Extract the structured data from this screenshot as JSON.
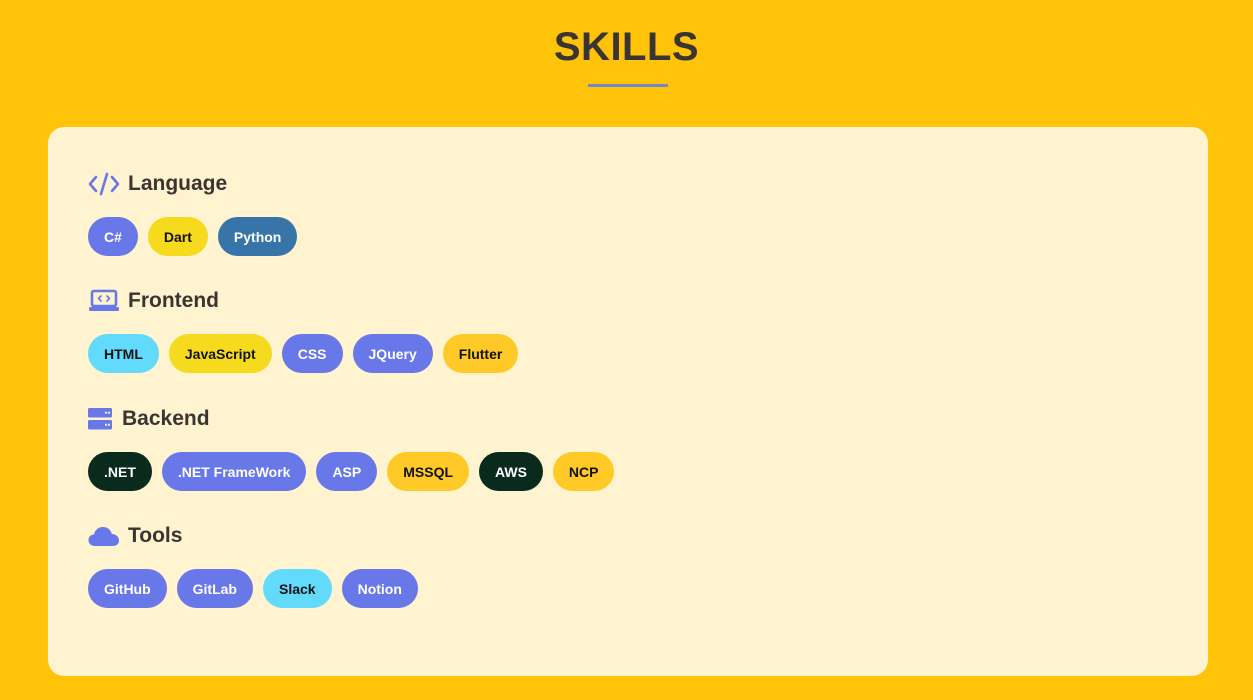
{
  "page": {
    "title": "SKILLS"
  },
  "colors": {
    "background": "#FFC30A",
    "card": "#FFF4CF",
    "accent": "#6978E8",
    "text": "#3A3433"
  },
  "sections": [
    {
      "id": "language",
      "icon": "code-icon",
      "title": "Language",
      "badges": [
        {
          "label": "C#",
          "bg": "#6978E8",
          "fg": "#FFFFFF"
        },
        {
          "label": "Dart",
          "bg": "#F5DA1D",
          "fg": "#111111"
        },
        {
          "label": "Python",
          "bg": "#3775A9",
          "fg": "#FFFFFF"
        }
      ]
    },
    {
      "id": "frontend",
      "icon": "laptop-code-icon",
      "title": "Frontend",
      "badges": [
        {
          "label": "HTML",
          "bg": "#61DAFB",
          "fg": "#111111"
        },
        {
          "label": "JavaScript",
          "bg": "#F5DA1D",
          "fg": "#111111"
        },
        {
          "label": "CSS",
          "bg": "#6978E8",
          "fg": "#FFFFFF"
        },
        {
          "label": "JQuery",
          "bg": "#6978E8",
          "fg": "#FFFFFF"
        },
        {
          "label": "Flutter",
          "bg": "#FFCA28",
          "fg": "#111111"
        }
      ]
    },
    {
      "id": "backend",
      "icon": "server-icon",
      "title": "Backend",
      "badges": [
        {
          "label": ".NET",
          "bg": "#0B2A1E",
          "fg": "#FFFFFF"
        },
        {
          "label": ".NET FrameWork",
          "bg": "#6978E8",
          "fg": "#FFFFFF"
        },
        {
          "label": "ASP",
          "bg": "#6978E8",
          "fg": "#FFFFFF"
        },
        {
          "label": "MSSQL",
          "bg": "#FFCA28",
          "fg": "#111111"
        },
        {
          "label": "AWS",
          "bg": "#0B2A1E",
          "fg": "#FFFFFF"
        },
        {
          "label": "NCP",
          "bg": "#FFCA28",
          "fg": "#111111"
        }
      ]
    },
    {
      "id": "tools",
      "icon": "cloud-icon",
      "title": "Tools",
      "badges": [
        {
          "label": "GitHub",
          "bg": "#6978E8",
          "fg": "#FFFFFF"
        },
        {
          "label": "GitLab",
          "bg": "#6978E8",
          "fg": "#FFFFFF"
        },
        {
          "label": "Slack",
          "bg": "#61DAFB",
          "fg": "#111111"
        },
        {
          "label": "Notion",
          "bg": "#6978E8",
          "fg": "#FFFFFF"
        }
      ]
    }
  ]
}
